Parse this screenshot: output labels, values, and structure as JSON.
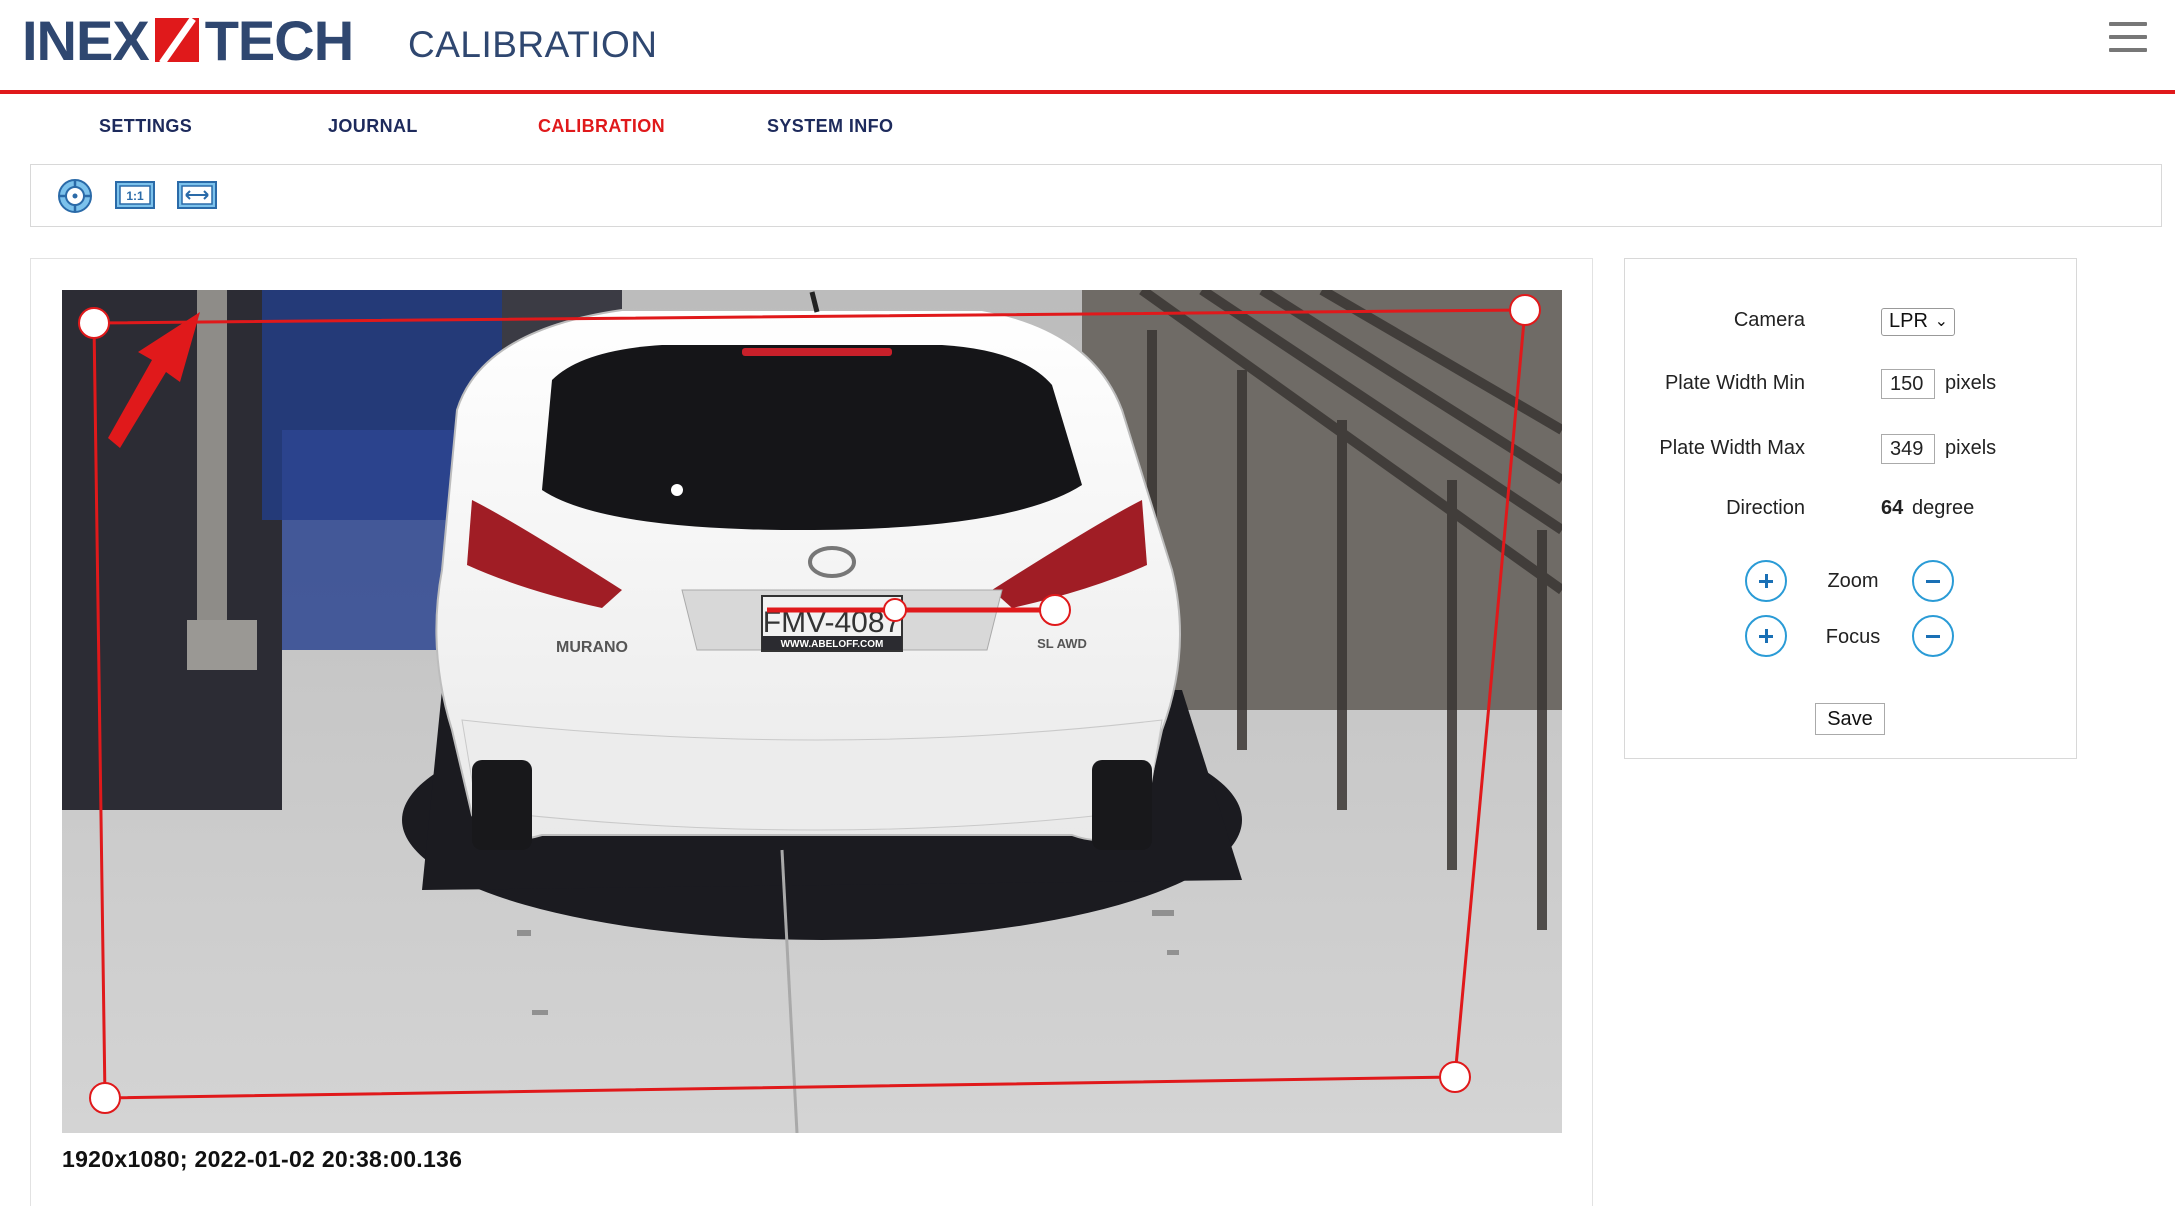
{
  "header": {
    "logo_left": "INEX",
    "logo_right": "TECH",
    "page_title": "CALIBRATION"
  },
  "nav": {
    "items": [
      {
        "label": "SETTINGS",
        "active": false
      },
      {
        "label": "JOURNAL",
        "active": false
      },
      {
        "label": "CALIBRATION",
        "active": true
      },
      {
        "label": "SYSTEM INFO",
        "active": false
      }
    ]
  },
  "toolbar": {
    "tools": [
      "target-icon",
      "fit-1to1-icon",
      "stretch-width-icon"
    ]
  },
  "video": {
    "info": "1920x1080;  2022-01-02 20:38:00.136",
    "plate_text": "FMV-4087",
    "plate_dealer": "WWW.ABELOFF.COM",
    "model_badge": "MURANO",
    "trim_badge": "SL AWD"
  },
  "settings": {
    "camera_label": "Camera",
    "camera_value": "LPR",
    "plate_min_label": "Plate Width Min",
    "plate_min_value": "150",
    "plate_max_label": "Plate Width Max",
    "plate_max_value": "349",
    "pixels_unit": "pixels",
    "direction_label": "Direction",
    "direction_value": "64",
    "direction_unit": "degree",
    "zoom_label": "Zoom",
    "focus_label": "Focus",
    "save_label": "Save"
  },
  "colors": {
    "brand_blue": "#2f4770",
    "accent_red": "#e0191b",
    "nav_text": "#1d2a5c",
    "button_blue": "#2a9bd6"
  }
}
